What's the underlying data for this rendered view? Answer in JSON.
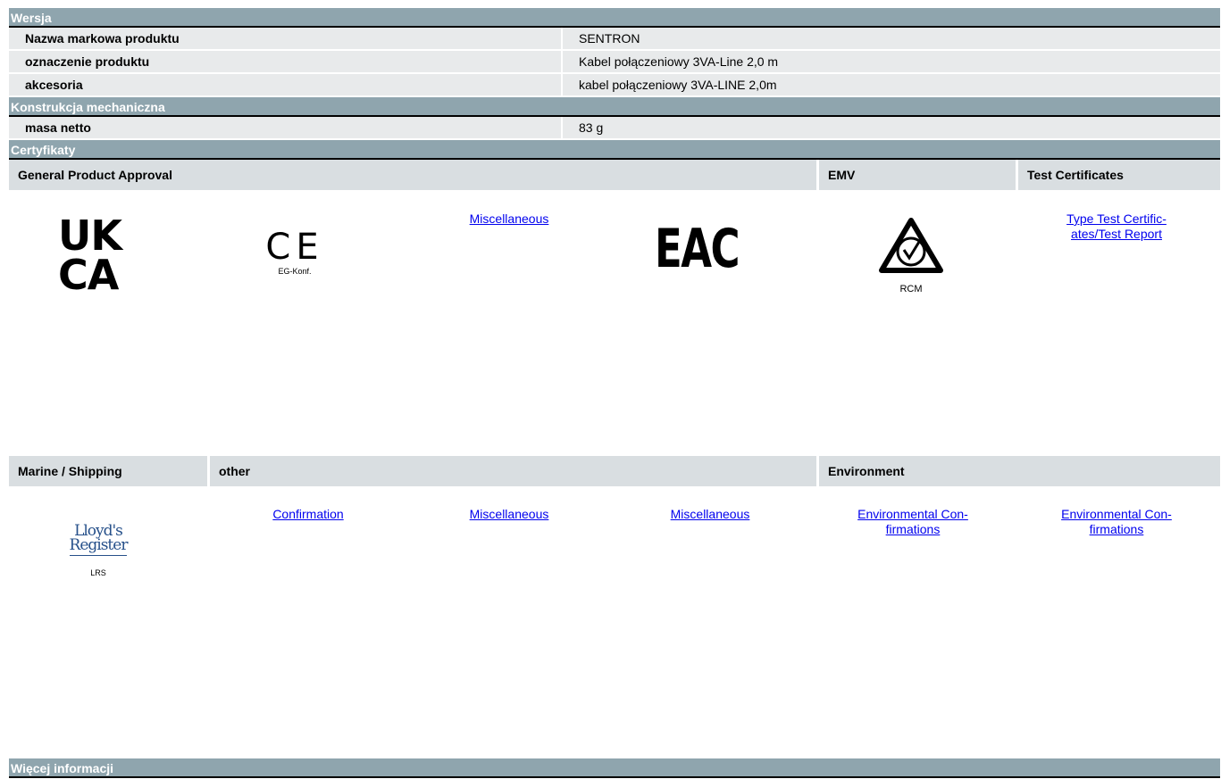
{
  "sections": {
    "wersja": {
      "title": "Wersja",
      "rows": [
        {
          "label": "Nazwa markowa produktu",
          "value": "SENTRON"
        },
        {
          "label": "oznaczenie produktu",
          "value": "Kabel połączeniowy 3VA-Line 2,0 m"
        },
        {
          "label": "akcesoria",
          "value": "kabel połączeniowy 3VA-LINE 2,0m"
        }
      ]
    },
    "konstrukcja": {
      "title": "Konstrukcja mechaniczna",
      "rows": [
        {
          "label": "masa netto",
          "value": "83 g"
        }
      ]
    },
    "certyfikaty": {
      "title": "Certyfikaty",
      "group1_headers": {
        "general": "General Product Approval",
        "emv": "EMV",
        "test": "Test Certificates"
      },
      "group1": {
        "ukca_line1": "UK",
        "ukca_line2": "CA",
        "ce_mark": "CE",
        "ce_caption": "EG-Konf.",
        "misc1": "Miscellaneous",
        "eac_mark": "EAC",
        "rcm_caption": "RCM",
        "test_line1": "Type Test Certific-",
        "test_line2": "ates/Test Report"
      },
      "group2_headers": {
        "marine": "Marine / Shipping",
        "other": "other",
        "environment": "Environment"
      },
      "group2": {
        "lloyds_line1": "Lloyd's",
        "lloyds_line2": "Register",
        "lloyds_caption": "LRS",
        "confirmation": "Confirmation",
        "misc2": "Miscellaneous",
        "misc3": "Miscellaneous",
        "env1_line1": "Environmental Con-",
        "env1_line2": "firmations",
        "env2_line1": "Environmental Con-",
        "env2_line2": "firmations"
      }
    },
    "wiecej": {
      "title": "Więcej informacji"
    }
  }
}
